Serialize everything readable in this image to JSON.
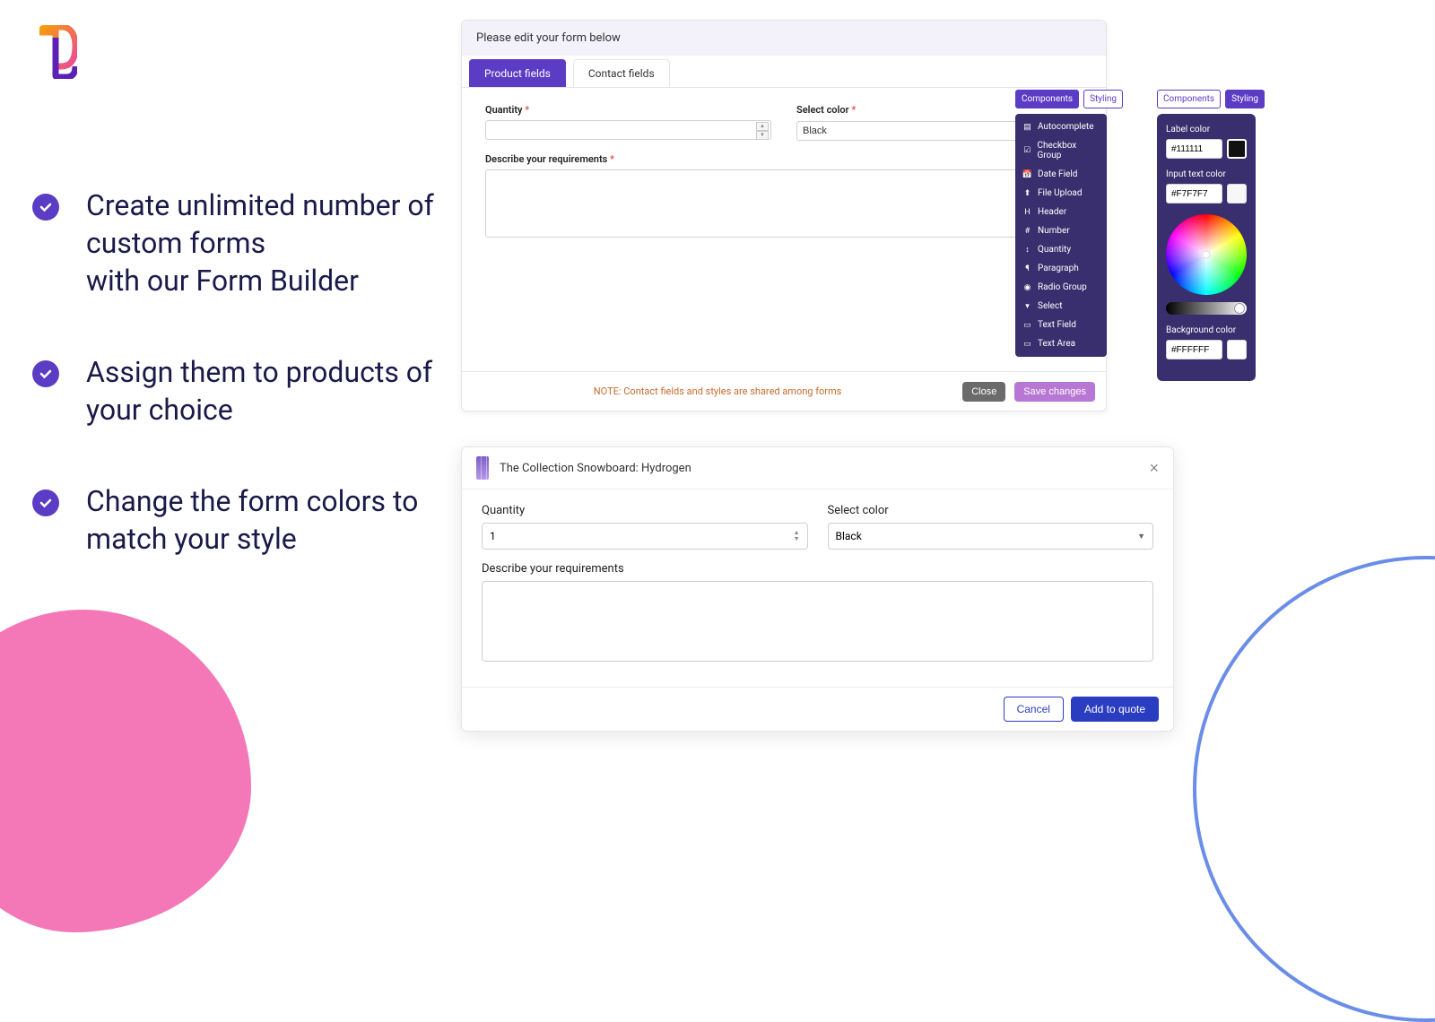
{
  "features": [
    "Create unlimited number of custom forms\nwith our Form Builder",
    "Assign them to products of your choice",
    "Change the form colors to match your style"
  ],
  "builder": {
    "header": "Please edit your form below",
    "tabs": {
      "product": "Product fields",
      "contact": "Contact fields"
    },
    "fields": {
      "quantity_label": "Quantity",
      "quantity_value": "",
      "color_label": "Select color",
      "color_value": "Black",
      "requirements_label": "Describe your requirements",
      "requirements_value": ""
    },
    "footer_note": "NOTE: Contact fields and styles are shared among forms",
    "buttons": {
      "close": "Close",
      "save": "Save changes"
    }
  },
  "palette": {
    "tabs": {
      "components": "Components",
      "styling": "Styling"
    },
    "items": [
      {
        "icon": "▤",
        "label": "Autocomplete"
      },
      {
        "icon": "☑",
        "label": "Checkbox Group"
      },
      {
        "icon": "📅",
        "label": "Date Field"
      },
      {
        "icon": "⬆",
        "label": "File Upload"
      },
      {
        "icon": "H",
        "label": "Header"
      },
      {
        "icon": "#",
        "label": "Number"
      },
      {
        "icon": "↕",
        "label": "Quantity"
      },
      {
        "icon": "¶",
        "label": "Paragraph"
      },
      {
        "icon": "◉",
        "label": "Radio Group"
      },
      {
        "icon": "▾",
        "label": "Select"
      },
      {
        "icon": "▭",
        "label": "Text Field"
      },
      {
        "icon": "▭",
        "label": "Text Area"
      }
    ]
  },
  "styling": {
    "tabs": {
      "components": "Components",
      "styling": "Styling"
    },
    "label_color": {
      "label": "Label color",
      "value": "#111111"
    },
    "input_text_color": {
      "label": "Input text color",
      "value": "#F7F7F7"
    },
    "background_color": {
      "label": "Background color",
      "value": "#FFFFFF"
    }
  },
  "modal": {
    "title": "The Collection Snowboard: Hydrogen",
    "quantity_label": "Quantity",
    "quantity_value": "1",
    "color_label": "Select color",
    "color_value": "Black",
    "requirements_label": "Describe your requirements",
    "requirements_value": "",
    "cancel": "Cancel",
    "add": "Add to quote"
  }
}
